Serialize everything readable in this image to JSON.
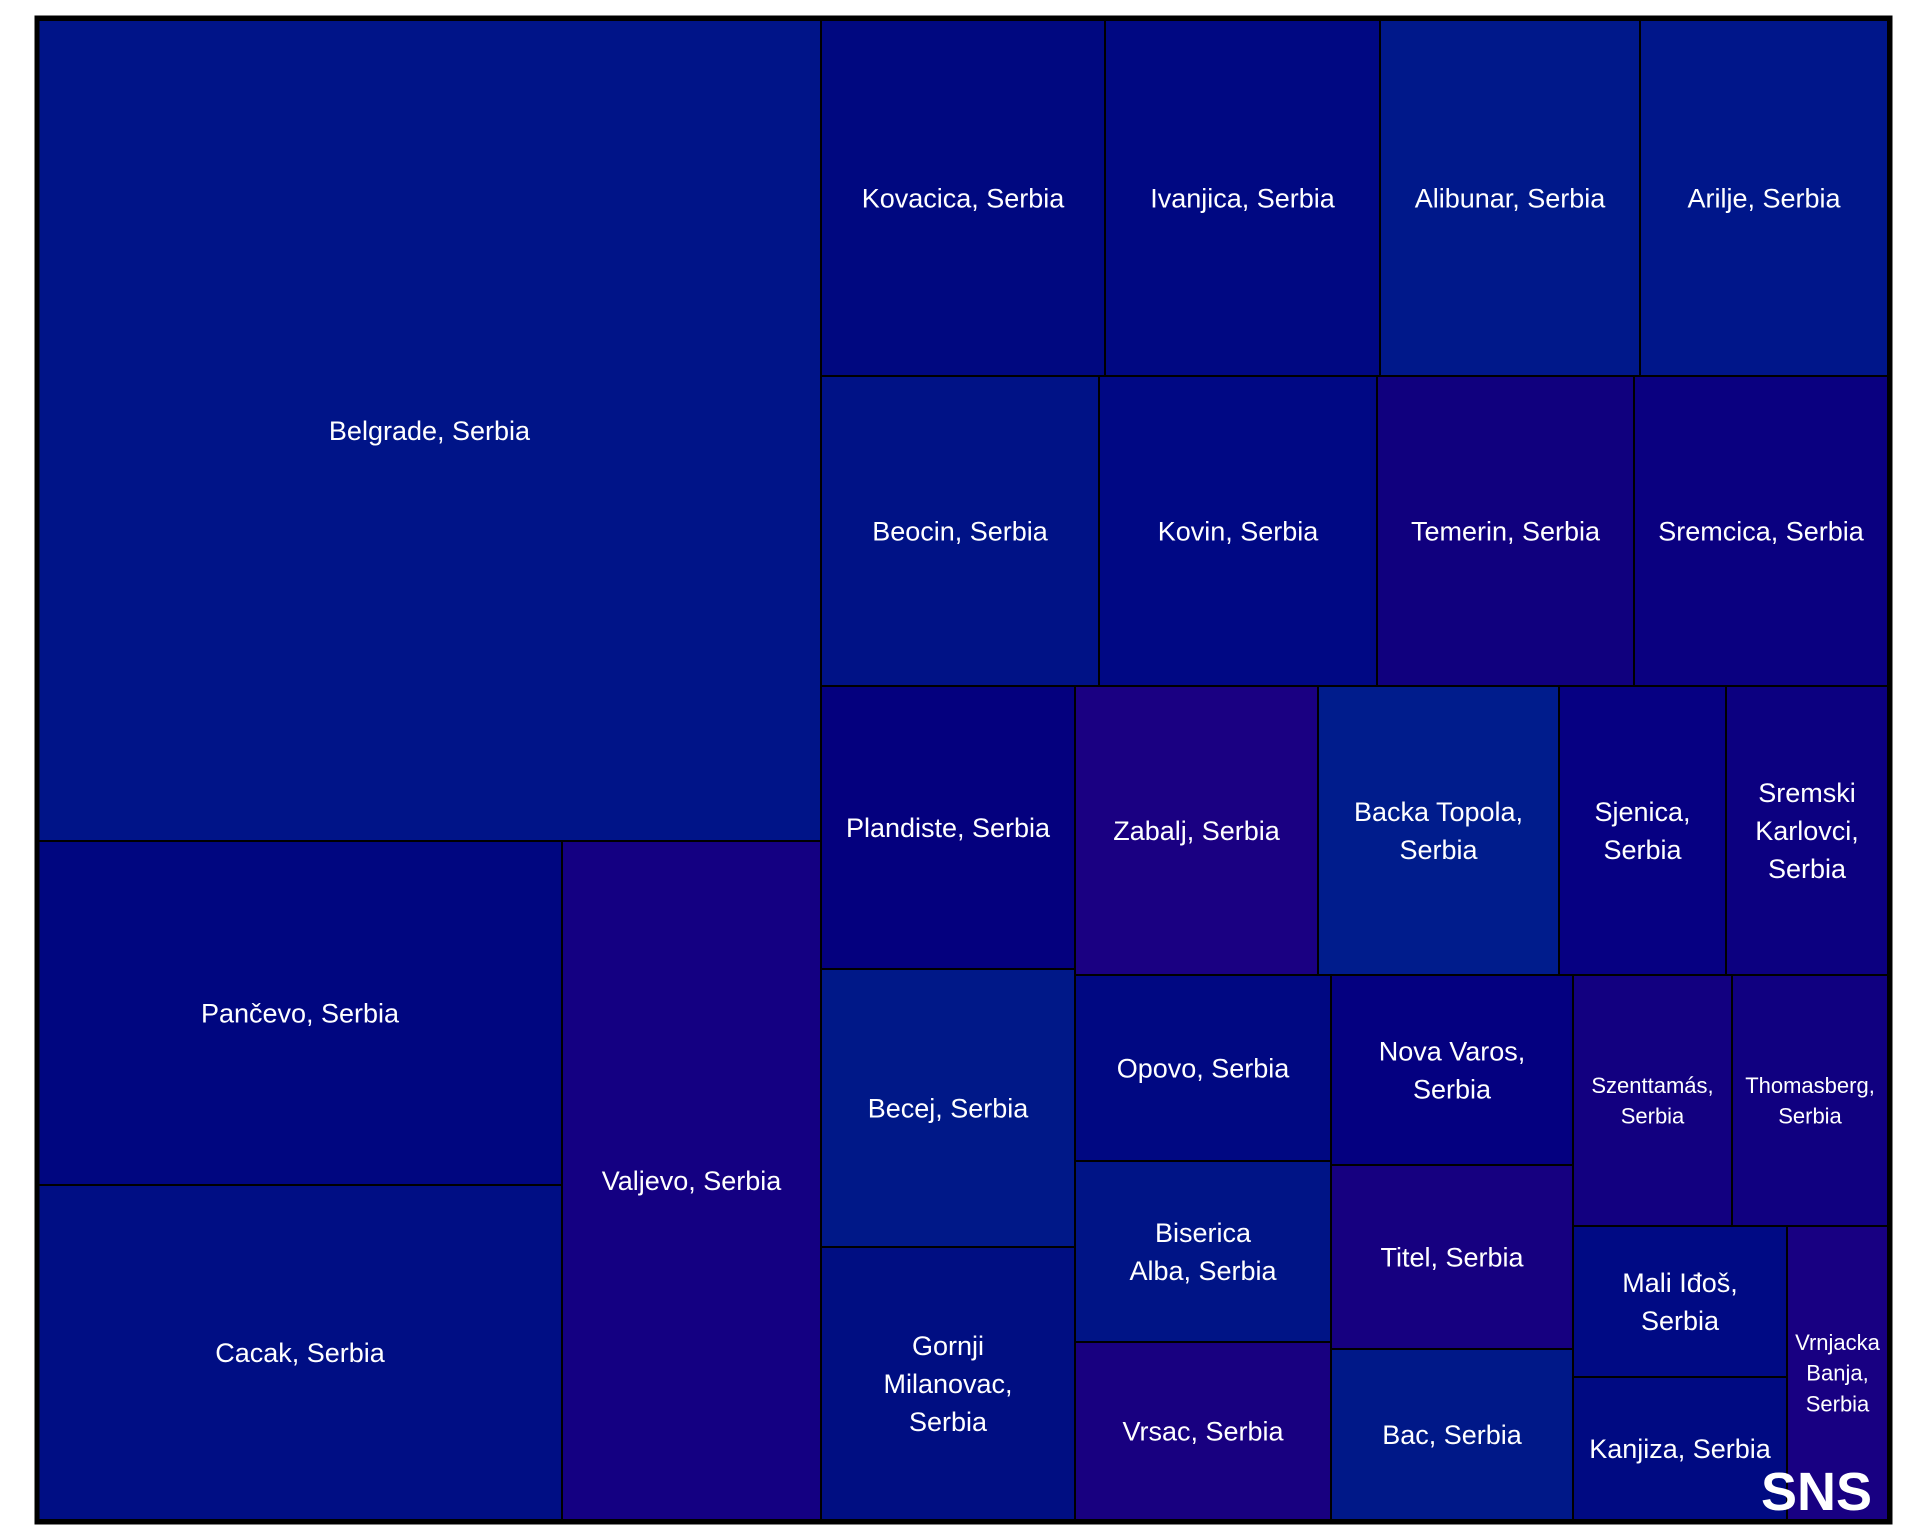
{
  "chart_data": {
    "type": "treemap",
    "badge": "SNS",
    "cells": [
      {
        "label": "Belgrade, Serbia",
        "color": "#001488"
      },
      {
        "label": "Pančevo, Serbia",
        "color": "#000680"
      },
      {
        "label": "Cacak, Serbia",
        "color": "#000e84"
      },
      {
        "label": "Valjevo, Serbia",
        "color": "#140082"
      },
      {
        "label": "Kovacica, Serbia",
        "color": "#000880"
      },
      {
        "label": "Ivanjica, Serbia",
        "color": "#000882"
      },
      {
        "label": "Alibunar, Serbia",
        "color": "#00188a"
      },
      {
        "label": "Arilje, Serbia",
        "color": "#00168a"
      },
      {
        "label": "Beocin, Serbia",
        "color": "#001286"
      },
      {
        "label": "Kovin, Serbia",
        "color": "#000884"
      },
      {
        "label": "Temerin, Serbia",
        "color": "#10007e"
      },
      {
        "label": "Sremcica, Serbia",
        "color": "#0a0080"
      },
      {
        "label": "Plandiste, Serbia",
        "color": "#04007e"
      },
      {
        "label": "Zabalj, Serbia",
        "color": "#1a0082"
      },
      {
        "label": "Backa Topola, Serbia",
        "color": "#001c8c"
      },
      {
        "label": "Sjenica, Serbia",
        "color": "#060082"
      },
      {
        "label": "Sremski Karlovci, Serbia",
        "color": "#0c0080"
      },
      {
        "label": "Becej, Serbia",
        "color": "#001888"
      },
      {
        "label": "Gornji Milanovac, Serbia",
        "color": "#000e82"
      },
      {
        "label": "Opovo, Serbia",
        "color": "#000882"
      },
      {
        "label": "Biserica Alba, Serbia",
        "color": "#001486"
      },
      {
        "label": "Vrsac, Serbia",
        "color": "#180080"
      },
      {
        "label": "Nova Varos, Serbia",
        "color": "#040080"
      },
      {
        "label": "Titel, Serbia",
        "color": "#160080"
      },
      {
        "label": "Bac, Serbia",
        "color": "#001888"
      },
      {
        "label": "Szenttamás, Serbia",
        "color": "#120080"
      },
      {
        "label": "Thomasberg, Serbia",
        "color": "#100080"
      },
      {
        "label": "Mali Iđoš, Serbia",
        "color": "#000a84"
      },
      {
        "label": "Kanjiza, Serbia",
        "color": "#000a82"
      },
      {
        "label": "Vrnjacka Banja, Serbia",
        "color": "#180082"
      }
    ]
  }
}
